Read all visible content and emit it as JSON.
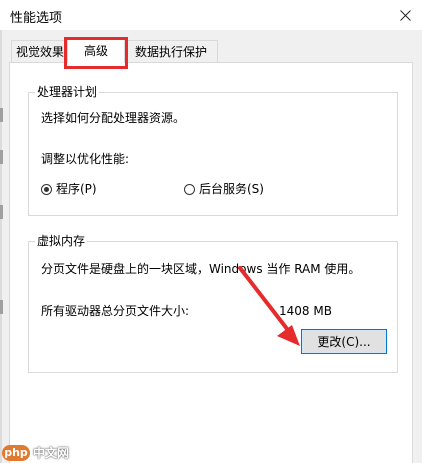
{
  "window": {
    "title": "性能选项",
    "close_icon": "close-icon"
  },
  "tabs": [
    {
      "label": "视觉效果",
      "active": false
    },
    {
      "label": "高级",
      "active": true
    },
    {
      "label": "数据执行保护",
      "active": false
    }
  ],
  "processor_group": {
    "legend": "处理器计划",
    "description": "选择如何分配处理器资源。",
    "adjust_label": "调整以优化性能:",
    "options": [
      {
        "label": "程序(P)",
        "selected": true
      },
      {
        "label": "后台服务(S)",
        "selected": false
      }
    ]
  },
  "vm_group": {
    "legend": "虚拟内存",
    "description": "分页文件是硬盘上的一块区域，Windows 当作 RAM 使用。",
    "total_label": "所有驱动器总分页文件大小:",
    "total_value": "1408 MB",
    "change_button": "更改(C)..."
  },
  "annotation": {
    "highlight_color": "#e52b2b"
  },
  "watermark": {
    "logo": "php",
    "text": "中文网"
  }
}
